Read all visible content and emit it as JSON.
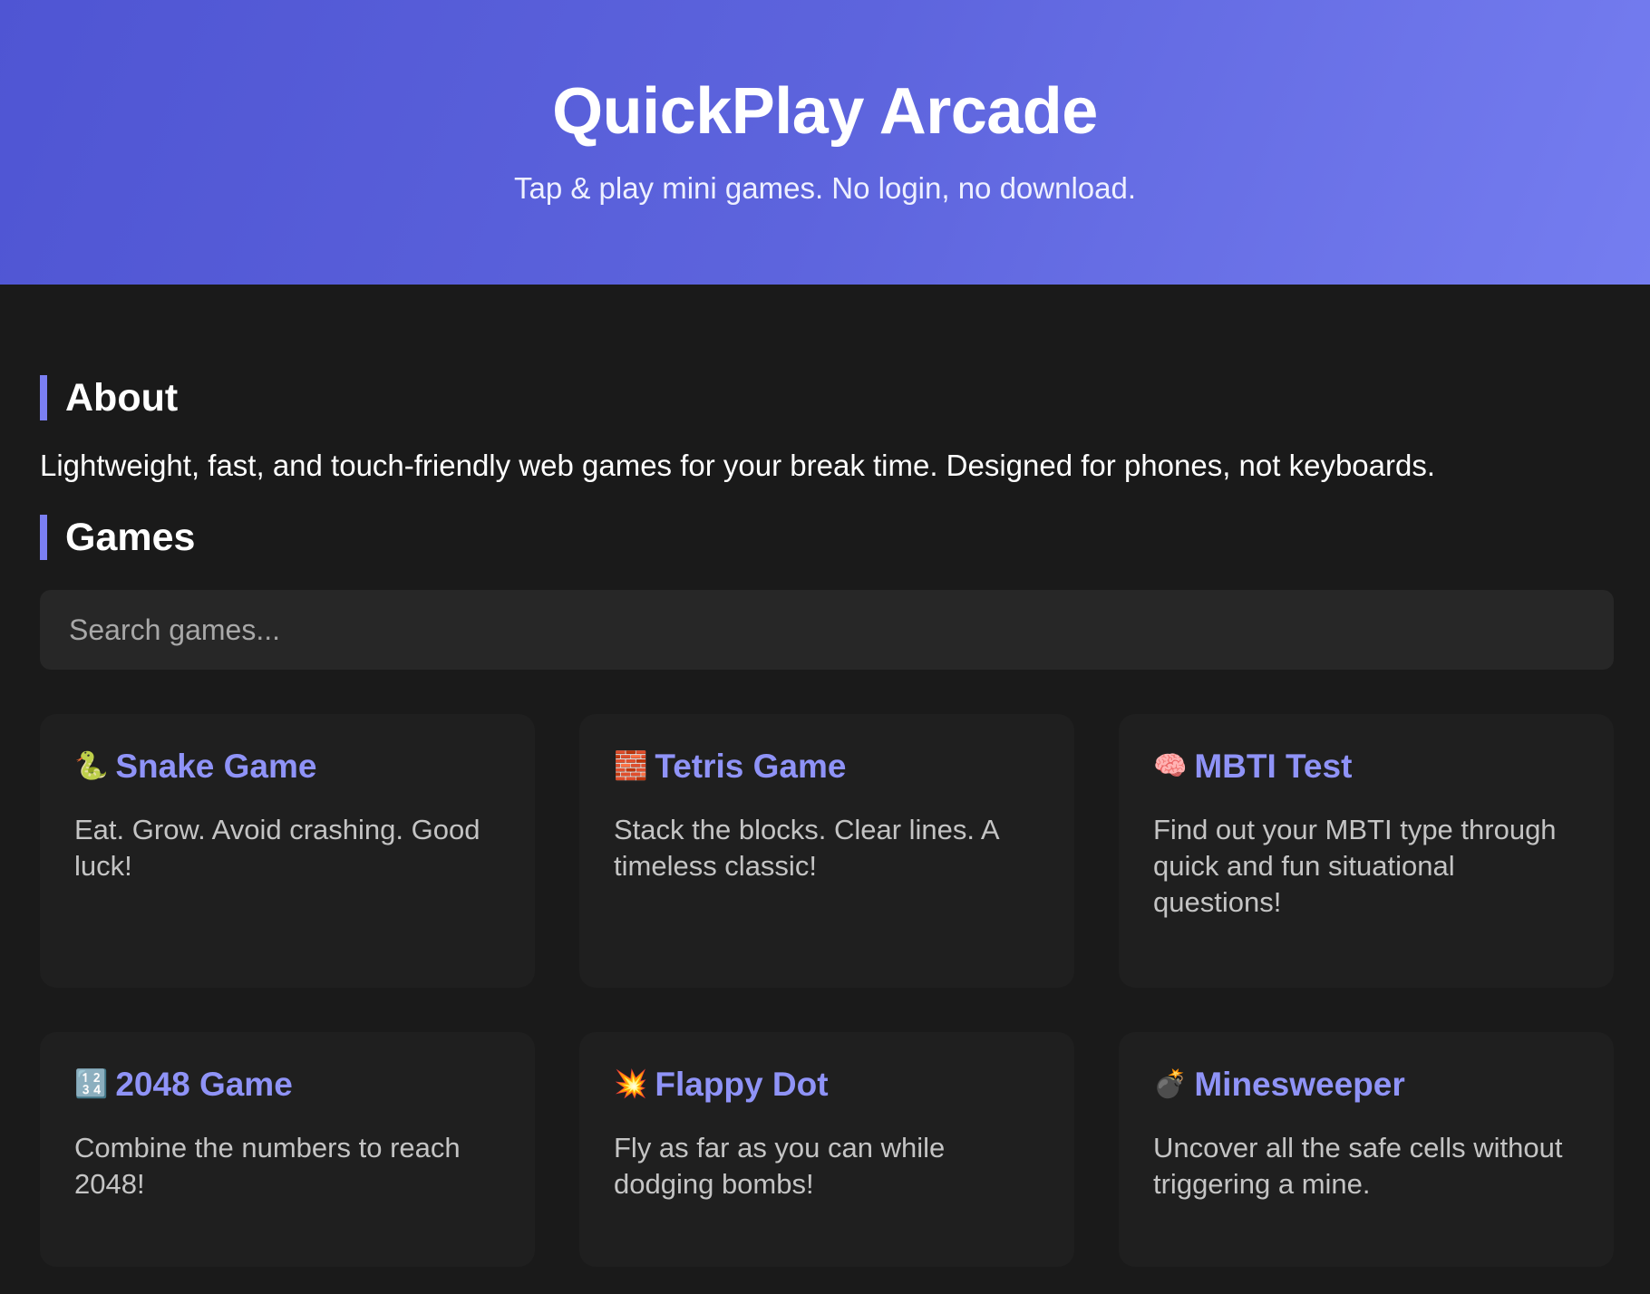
{
  "header": {
    "title": "QuickPlay Arcade",
    "subtitle": "Tap & play mini games. No login, no download."
  },
  "about": {
    "heading": "About",
    "text": "Lightweight, fast, and touch-friendly web games for your break time. Designed for phones, not keyboards."
  },
  "games_section": {
    "heading": "Games",
    "search_placeholder": "Search games..."
  },
  "games": [
    {
      "icon": "🐍",
      "icon_name": "snake-icon",
      "title": "Snake Game",
      "description": "Eat. Grow. Avoid crashing. Good luck!"
    },
    {
      "icon": "🧱",
      "icon_name": "brick-icon",
      "title": "Tetris Game",
      "description": "Stack the blocks. Clear lines. A timeless classic!"
    },
    {
      "icon": "🧠",
      "icon_name": "brain-icon",
      "title": "MBTI Test",
      "description": "Find out your MBTI type through quick and fun situational questions!"
    },
    {
      "icon": "🔢",
      "icon_name": "numbers-icon",
      "title": "2048 Game",
      "description": "Combine the numbers to reach 2048!"
    },
    {
      "icon": "💥",
      "icon_name": "explosion-icon",
      "title": "Flappy Dot",
      "description": "Fly as far as you can while dodging bombs!"
    },
    {
      "icon": "💣",
      "icon_name": "bomb-icon",
      "title": "Minesweeper",
      "description": "Uncover all the safe cells without triggering a mine."
    }
  ],
  "colors": {
    "accent": "#7b7ff2",
    "card_title": "#8f93f7",
    "background": "#1a1a1a",
    "card_background": "#1f1f1f"
  }
}
